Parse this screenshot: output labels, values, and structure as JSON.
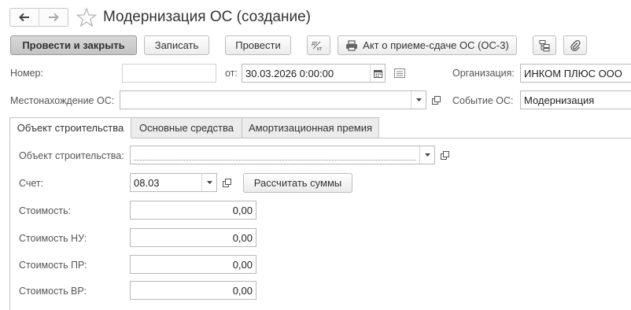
{
  "header": {
    "title": "Модернизация ОС (создание)"
  },
  "toolbar": {
    "post_close": "Провести и закрыть",
    "save": "Записать",
    "post": "Провести",
    "act": "Акт о приеме-сдаче ОС (ОС-3)"
  },
  "form": {
    "number_label": "Номер:",
    "number_value": "",
    "date_label": "от:",
    "date_value": "30.03.2026  0:00:00",
    "org_label": "Организация:",
    "org_value": "ИНКОМ ПЛЮС ООО",
    "location_label": "Местонахождение ОС:",
    "location_value": "",
    "event_label": "Событие ОС:",
    "event_value": "Модернизация"
  },
  "tabs": [
    {
      "label": "Объект строительства"
    },
    {
      "label": "Основные средства"
    },
    {
      "label": "Амортизационная премия"
    }
  ],
  "tab_content": {
    "construction_label": "Объект строительства:",
    "construction_value": "",
    "account_label": "Счет:",
    "account_value": "08.03",
    "calc_button": "Рассчитать суммы",
    "cost_label": "Стоимость:",
    "cost_value": "0,00",
    "cost_nu_label": "Стоимость НУ:",
    "cost_nu_value": "0,00",
    "cost_pr_label": "Стоимость ПР:",
    "cost_pr_value": "0,00",
    "cost_vr_label": "Стоимость ВР:",
    "cost_vr_value": "0,00"
  }
}
